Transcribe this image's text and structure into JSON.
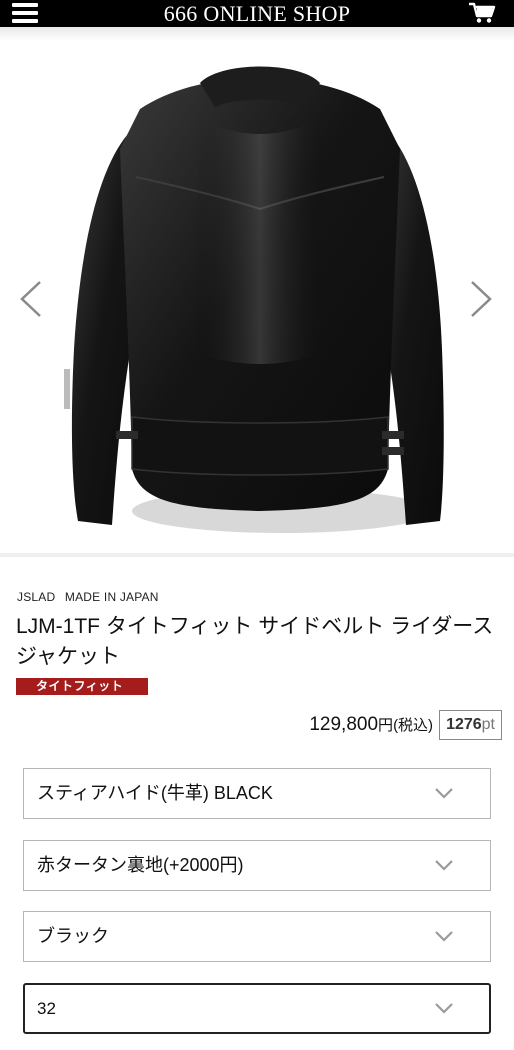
{
  "header": {
    "title": "666 ONLINE SHOP",
    "menu_icon": "hamburger-menu-icon",
    "cart_icon": "shopping-cart-icon"
  },
  "gallery": {
    "image_subject": "black leather riders jacket, back view",
    "prev_icon": "chevron-left-icon",
    "next_icon": "chevron-right-icon"
  },
  "product": {
    "brand": "JSLAD",
    "origin": "MADE IN JAPAN",
    "name": "LJM-1TF タイトフィット サイドベルト ライダースジャケット",
    "badge": "タイトフィット",
    "badge_color": "#a51c1c",
    "price_number": "129,800",
    "price_yen": "円",
    "price_tax": "(税込)",
    "points_number": "1276",
    "points_unit": "pt"
  },
  "options": [
    {
      "value": "スティアハイド(牛革) BLACK"
    },
    {
      "value": "赤タータン裏地(+2000円)"
    },
    {
      "value": "ブラック"
    },
    {
      "value": "32"
    }
  ]
}
